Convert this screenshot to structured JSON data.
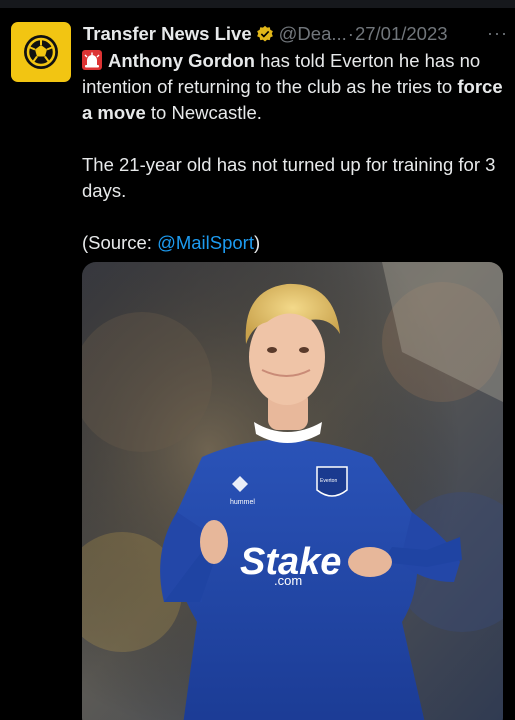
{
  "account": {
    "name": "Transfer News Live",
    "handle": "@Dea...",
    "separator": "·",
    "date": "27/01/2023",
    "more_icon": "more-icon",
    "avatar_icon": "football-icon",
    "brand_color": "#f2c512",
    "verified_color": "#e2b719"
  },
  "tweet": {
    "player_name": "Anthony Gordon",
    "line1_rest": " has told Everton he has no intention of returning to the club as he tries to ",
    "force_move": "force a move",
    "line1_end": " to Newcastle.",
    "para2": "The 21-year old has not turned up for training for 3 days.",
    "source_prefix": "(Source: ",
    "source_mention": "@MailSport",
    "source_suffix": ")",
    "link_color": "#1d9bf0"
  },
  "media": {
    "shirt_sponsor": "Stake",
    "shirt_sponsor_sub": ".com",
    "kit_brand": "hummel",
    "crest_text": "Everton"
  }
}
